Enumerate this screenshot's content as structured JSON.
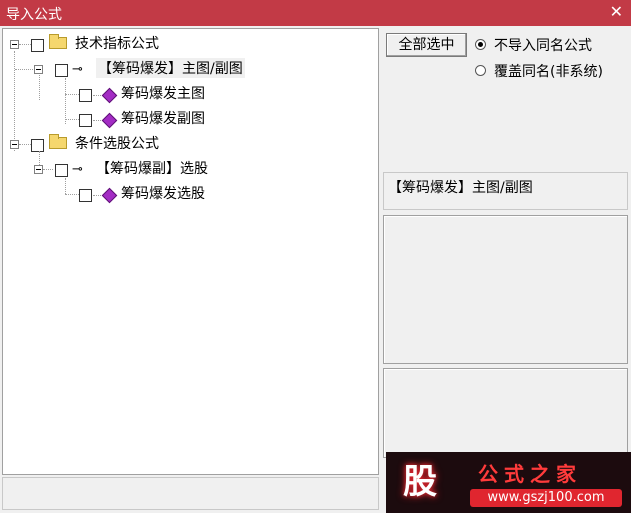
{
  "window": {
    "title": "导入公式",
    "close_glyph": "✕"
  },
  "tree": {
    "groups": [
      {
        "label": "技术指标公式",
        "formula": {
          "label": "【筹码爆发】主图/副图",
          "children": [
            "筹码爆发主图",
            "筹码爆发副图"
          ]
        }
      },
      {
        "label": "条件选股公式",
        "formula": {
          "label": "【筹码爆副】选股",
          "children": [
            "筹码爆发选股"
          ]
        }
      }
    ]
  },
  "actions": {
    "select_all": "全部选中"
  },
  "options": {
    "skip_same_name": "不导入同名公式",
    "overwrite_same_name": "覆盖同名(非系统)",
    "selected": "skip_same_name"
  },
  "detail": {
    "selected_formula": "【筹码爆发】主图/副图"
  },
  "watermark": {
    "mark": "股",
    "brand": "公式之家",
    "url": "www.gszj100.com"
  },
  "icons": {
    "group": "folder-icon",
    "formula": "key-icon",
    "item": "gem-icon"
  },
  "colors": {
    "titlebar": "#c23a46",
    "item_gem": "#a32cc4"
  }
}
